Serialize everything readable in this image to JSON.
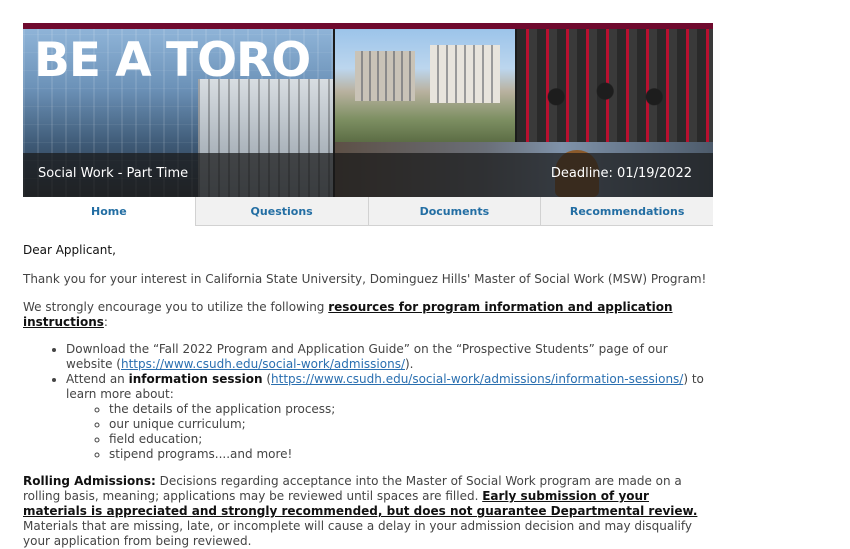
{
  "banner": {
    "headline": "BE A TORO",
    "program": "Social Work - Part Time",
    "deadline": "Deadline: 01/19/2022",
    "accent_color": "#6f0a2e"
  },
  "tabs": [
    {
      "label": "Home",
      "active": true
    },
    {
      "label": "Questions",
      "active": false
    },
    {
      "label": "Documents",
      "active": false
    },
    {
      "label": "Recommendations",
      "active": false
    }
  ],
  "content": {
    "greeting": "Dear Applicant,",
    "thanks": "Thank you for your interest in California State University, Dominguez Hills' Master of Social Work (MSW) Program!",
    "encourage_prefix": "We strongly encourage you to utilize the following ",
    "encourage_link": "resources for program information and application instructions",
    "encourage_suffix": ":",
    "bullet1_prefix": "Download the “Fall 2022 Program and Application Guide” on the “Prospective Students” page of our website (",
    "bullet1_link": "https://www.csudh.edu/social-work/admissions/",
    "bullet1_suffix": ").",
    "bullet2_prefix": "Attend an ",
    "bullet2_bold": "information session",
    "bullet2_mid": " (",
    "bullet2_link": "https://www.csudh.edu/social-work/admissions/information-sessions/",
    "bullet2_suffix": ") to learn more about:",
    "sub_items": [
      "the details of the application process;",
      "our unique curriculum;",
      "field education;",
      "stipend programs....and more!"
    ],
    "rolling_label": "Rolling Admissions:",
    "rolling_text1": " Decisions regarding acceptance into the Master of Social Work program are made on a rolling basis, meaning; applications may be reviewed until spaces are filled. ",
    "rolling_emph": "Early submission of your materials is appreciated and strongly recommended, but does not guarantee Departmental review.",
    "rolling_text2": " Materials that are missing, late, or incomplete will cause a delay in your admission decision and may disqualify your application from being reviewed."
  },
  "colors": {
    "tab_text": "#236ea3",
    "link": "#2a6fb0"
  }
}
